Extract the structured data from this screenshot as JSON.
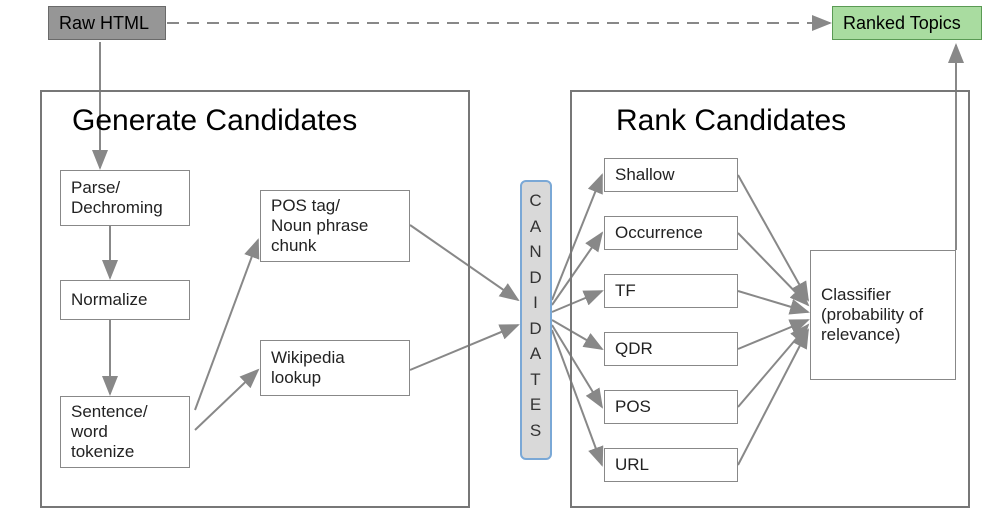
{
  "input": {
    "label": "Raw HTML"
  },
  "output": {
    "label": "Ranked Topics"
  },
  "generate": {
    "title": "Generate Candidates",
    "steps": {
      "parse": "Parse/\nDechroming",
      "normalize": "Normalize",
      "tokenize": "Sentence/\nword\ntokenize",
      "pos": "POS tag/\nNoun phrase\nchunk",
      "wiki": "Wikipedia\nlookup"
    }
  },
  "candidates_label": "CANDIDATES",
  "rank": {
    "title": "Rank Candidates",
    "features": {
      "shallow": "Shallow",
      "occurrence": "Occurrence",
      "tf": "TF",
      "qdr": "QDR",
      "pos": "POS",
      "url": "URL"
    },
    "classifier": "Classifier\n(probability of\nrelevance)"
  }
}
